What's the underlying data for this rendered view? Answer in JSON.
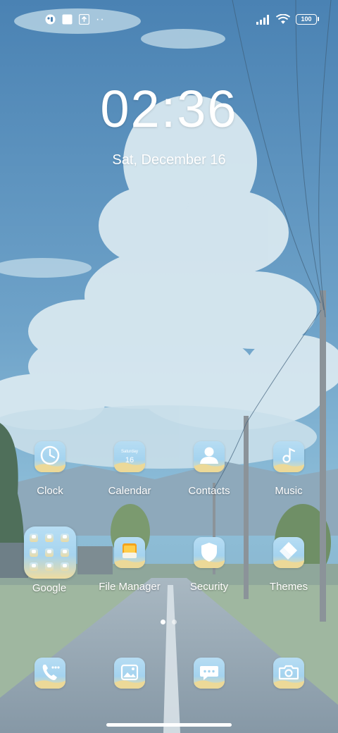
{
  "status_bar": {
    "left_icons": [
      "notification-icon",
      "square-notification-icon",
      "upload-icon"
    ],
    "more_dots": "··",
    "right_icons": [
      "signal-icon",
      "wifi-icon",
      "battery-icon"
    ],
    "battery_level": "100"
  },
  "lock_clock": {
    "time": "02:36",
    "date": "Sat, December 16"
  },
  "home_row_1": [
    {
      "label": "Clock",
      "icon": "clock-icon"
    },
    {
      "label": "Calendar",
      "icon": "calendar-icon",
      "icon_text_top": "Saturday",
      "icon_text_day": "16"
    },
    {
      "label": "Contacts",
      "icon": "contacts-icon"
    },
    {
      "label": "Music",
      "icon": "music-icon"
    }
  ],
  "home_row_2": [
    {
      "label": "Google",
      "icon": "folder-icon"
    },
    {
      "label": "File Manager",
      "icon": "file-manager-icon"
    },
    {
      "label": "Security",
      "icon": "shield-icon"
    },
    {
      "label": "Themes",
      "icon": "themes-icon"
    }
  ],
  "page_indicator": {
    "pages": 2,
    "current": 1
  },
  "dock": [
    {
      "icon": "phone-icon"
    },
    {
      "icon": "gallery-icon"
    },
    {
      "icon": "messages-icon"
    },
    {
      "icon": "camera-icon"
    }
  ],
  "colors": {
    "sky_top": "#4a82b3",
    "sky_bottom": "#8fbfd9",
    "icon_bg": "#a4d3ef",
    "icon_sand": "#f0dfa0",
    "text": "#ffffff"
  }
}
